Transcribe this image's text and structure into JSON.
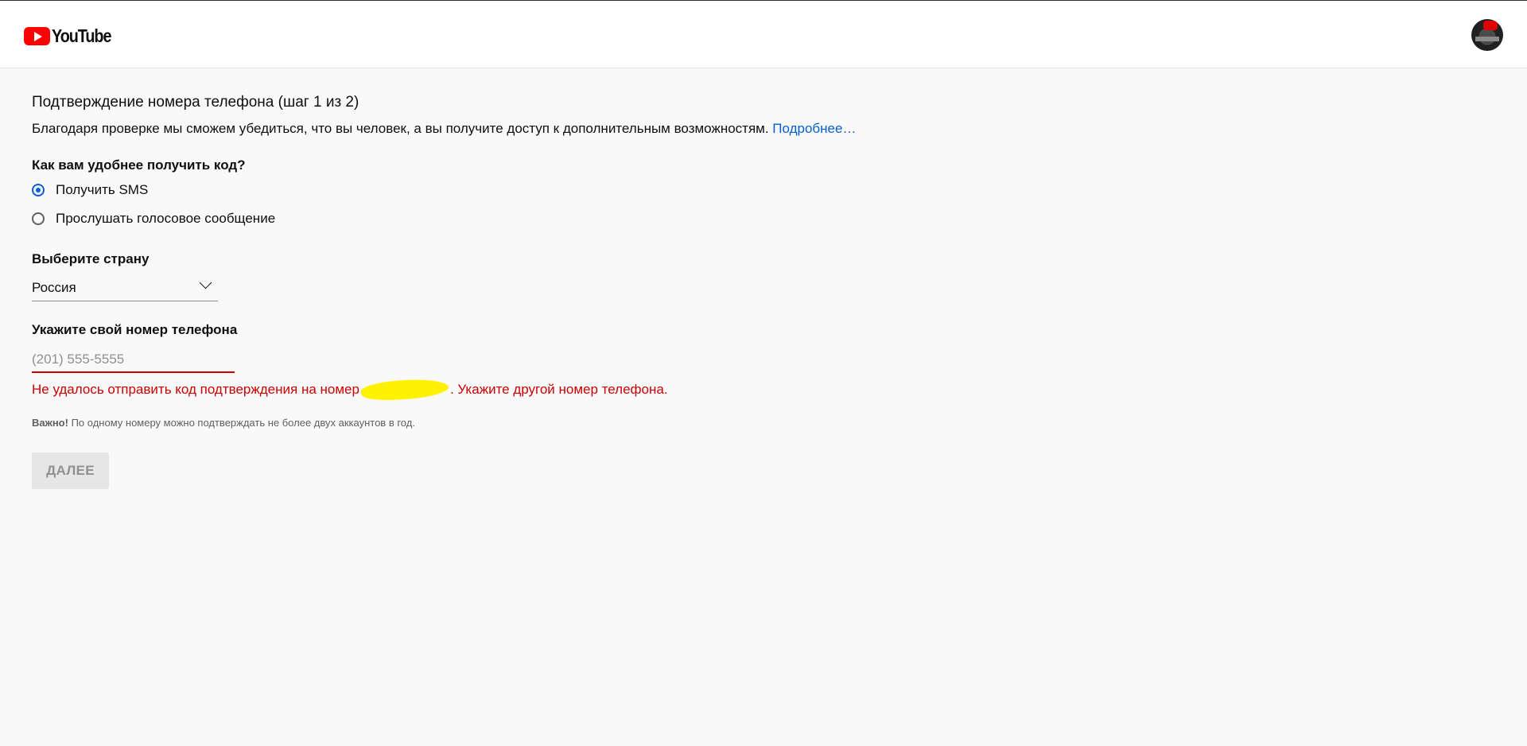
{
  "header": {
    "logo_text": "YouTube",
    "avatar_alt": "avatar"
  },
  "form": {
    "title": "Подтверждение номера телефона (шаг 1 из 2)",
    "subtitle": "Благодаря проверке мы сможем убедиться, что вы человек, а вы получите доступ к дополнительным возможностям.",
    "learn_more": "Подробнее…",
    "question": "Как вам удобнее получить код?",
    "options": [
      {
        "label": "Получить SMS",
        "selected": true
      },
      {
        "label": "Прослушать голосовое сообщение",
        "selected": false
      }
    ],
    "country_label": "Выберите страну",
    "country_value": "Россия",
    "phone_label": "Укажите свой номер телефона",
    "phone_placeholder": "(201) 555-5555",
    "phone_value": "",
    "error_prefix": "Не удалось отправить код подтверждения на номер",
    "error_suffix": ". Укажите другой номер телефона.",
    "note_bold": "Важно!",
    "note_text": " По одному номеру можно подтверждать не более двух аккаунтов в год.",
    "next_button": "ДАЛЕЕ"
  },
  "colors": {
    "accent": "#065fd4",
    "error": "#cc0000",
    "brand": "#ff0000",
    "redaction": "#fff200"
  }
}
